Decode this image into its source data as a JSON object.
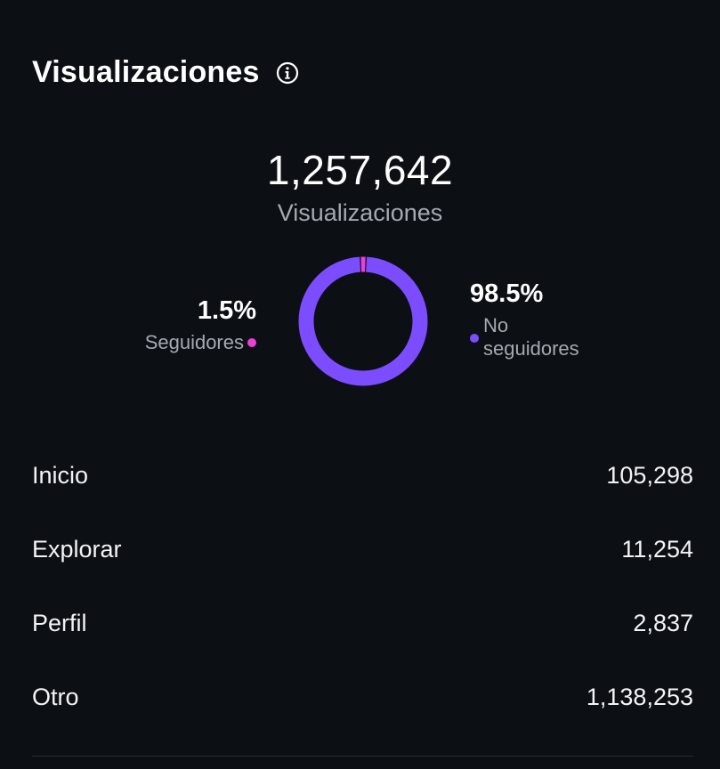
{
  "header": {
    "title": "Visualizaciones",
    "info_icon": "info-circle-icon"
  },
  "summary": {
    "total": "1,257,642",
    "total_label": "Visualizaciones"
  },
  "breakdown": {
    "followers": {
      "percent": "1.5%",
      "label": "Seguidores",
      "value": 1.5,
      "color": "#ec3fd9"
    },
    "non_followers": {
      "percent": "98.5%",
      "label": "No seguidores",
      "value": 98.5,
      "color": "#7c4dff"
    }
  },
  "sources": [
    {
      "label": "Inicio",
      "value": "105,298"
    },
    {
      "label": "Explorar",
      "value": "11,254"
    },
    {
      "label": "Perfil",
      "value": "2,837"
    },
    {
      "label": "Otro",
      "value": "1,138,253"
    }
  ]
}
